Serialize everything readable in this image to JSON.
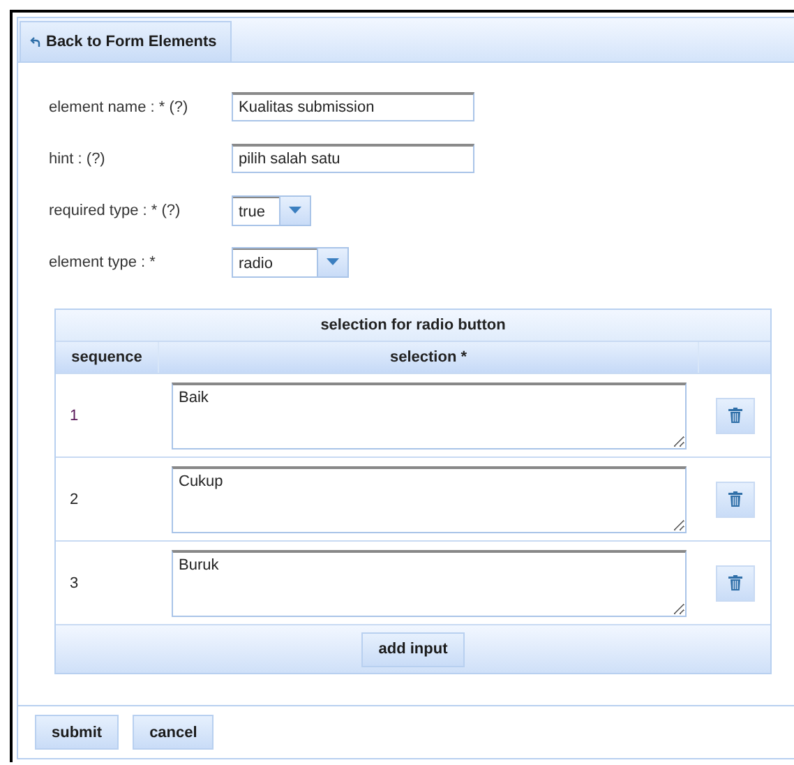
{
  "back_tab": {
    "label": "Back to Form Elements"
  },
  "fields": [
    {
      "kind": "text",
      "label": "element name : * (?)",
      "value": "Kualitas submission"
    },
    {
      "kind": "text",
      "label": "hint : (?)",
      "value": "pilih salah satu"
    },
    {
      "kind": "select",
      "label": "required type : * (?)",
      "value": "true"
    },
    {
      "kind": "select",
      "label": "element type : *",
      "value": "radio"
    }
  ],
  "selection_table": {
    "title": "selection for radio button",
    "columns": [
      "sequence",
      "selection *"
    ],
    "rows": [
      {
        "sequence": "1",
        "selection": "Baik"
      },
      {
        "sequence": "2",
        "selection": "Cukup"
      },
      {
        "sequence": "3",
        "selection": "Buruk"
      }
    ],
    "add_button": "add input"
  },
  "buttons": [
    "submit",
    "cancel"
  ]
}
